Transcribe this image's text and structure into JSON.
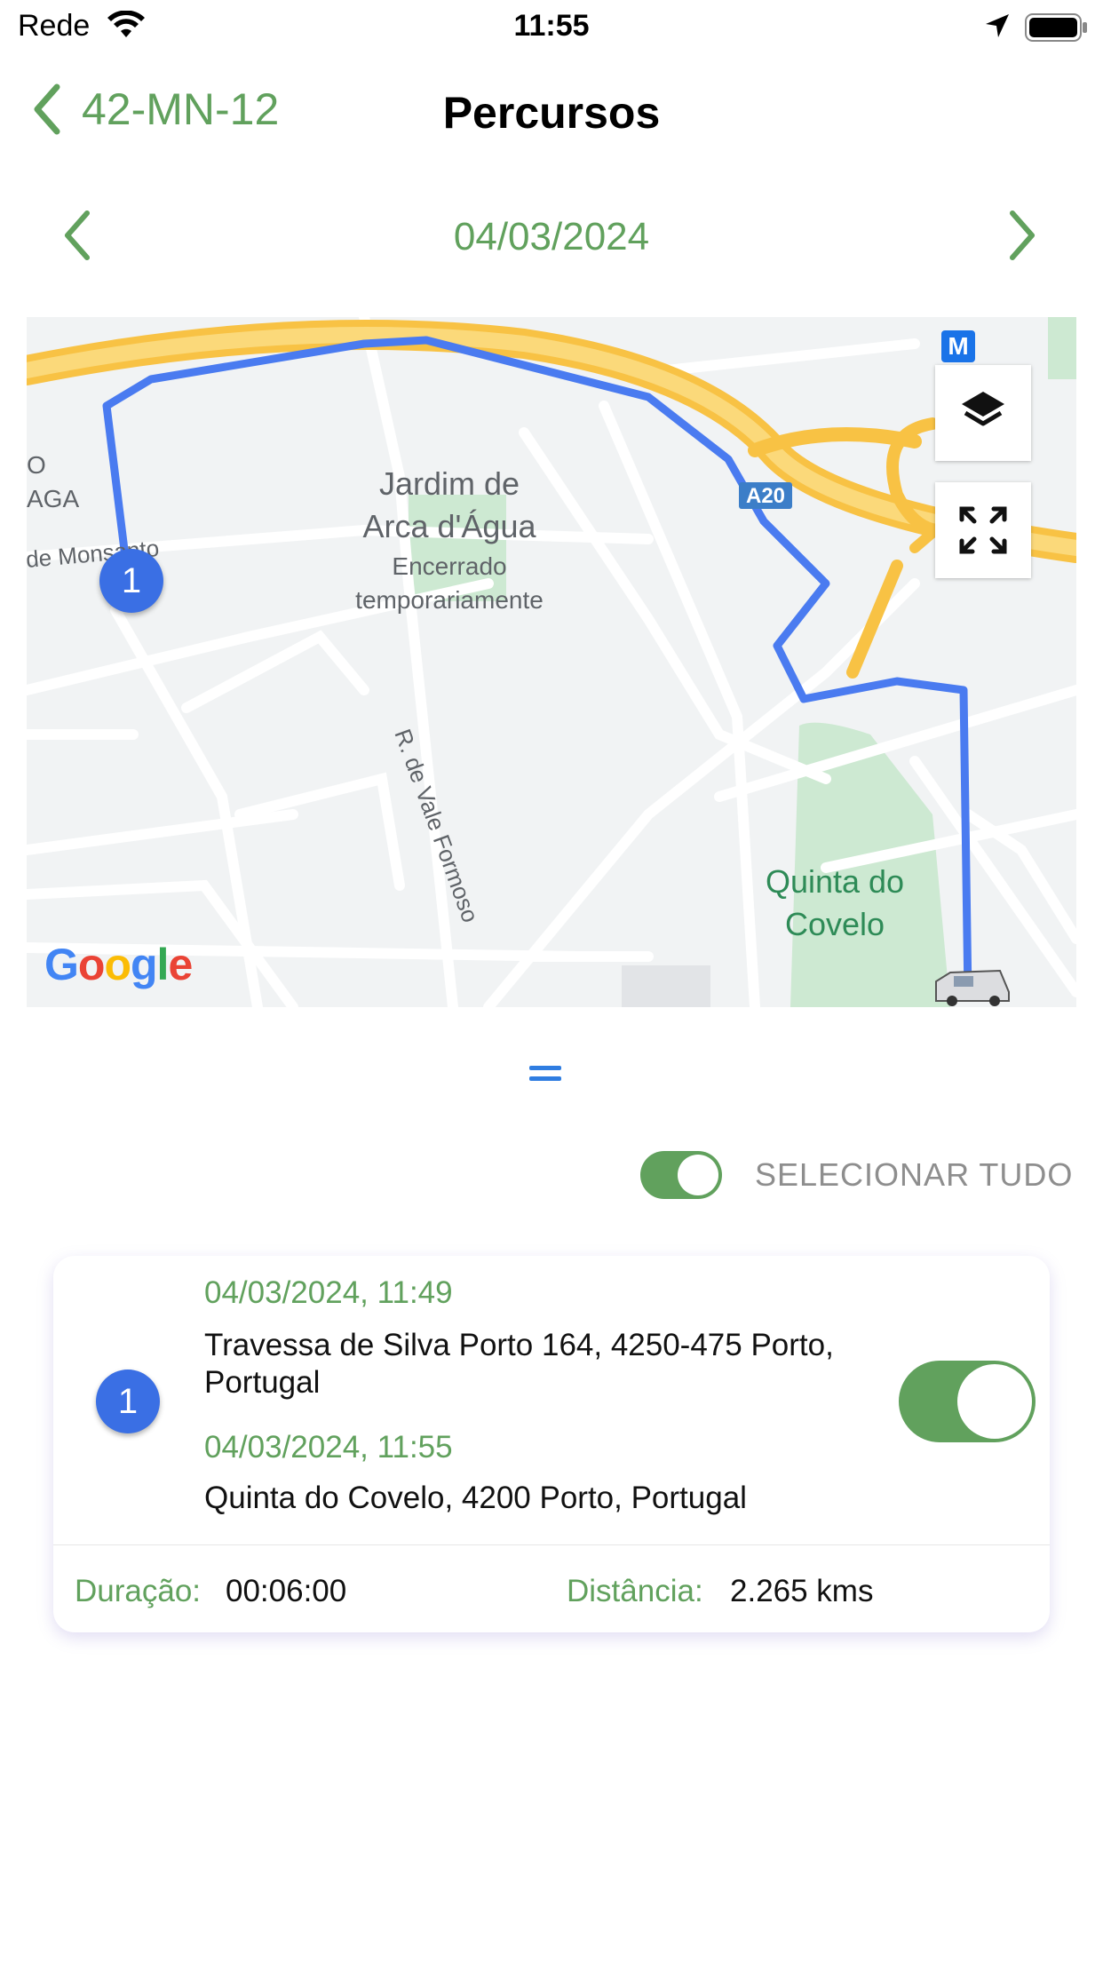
{
  "status_bar": {
    "carrier": "Rede",
    "time": "11:55"
  },
  "nav": {
    "back_label": "42-MN-12",
    "title": "Percursos"
  },
  "date_nav": {
    "date": "04/03/2024"
  },
  "map": {
    "labels": {
      "jardim": "Jardim de",
      "arca": "Arca d'Água",
      "encerrado": "Encerrado",
      "temporariamente": "temporariamente",
      "rua": "R. de Vale Formoso",
      "quinta": "Quinta do",
      "covelo": "Covelo",
      "monsanto": "de Monsanto",
      "o": "O",
      "aga": "AGA",
      "a20": "A20",
      "metro": "M"
    },
    "marker_number": "1",
    "brand": [
      "G",
      "o",
      "o",
      "g",
      "l",
      "e"
    ],
    "route_color": "#4a7bf0",
    "highway_color": "#f8c244",
    "park_color": "#cde9d2"
  },
  "select_all": {
    "label": "SELECIONAR TUDO",
    "on": true
  },
  "trip": {
    "number": "1",
    "start_datetime": "04/03/2024, 11:49",
    "start_address": "Travessa de Silva Porto 164, 4250-475 Porto, Portugal",
    "end_datetime": "04/03/2024, 11:55",
    "end_address": "Quinta do Covelo, 4200 Porto, Portugal",
    "selected": true,
    "duration_label": "Duração:",
    "duration_value": "00:06:00",
    "distance_label": "Distância:",
    "distance_value": "2.265 kms"
  },
  "colors": {
    "accent": "#61a15d",
    "marker": "#3a6fe4",
    "handle": "#2f7de1"
  },
  "icons": [
    "back-chevron-icon",
    "prev-chevron-icon",
    "next-chevron-icon",
    "layers-icon",
    "fullscreen-icon",
    "wifi-icon",
    "location-arrow-icon",
    "battery-icon",
    "car-icon"
  ]
}
